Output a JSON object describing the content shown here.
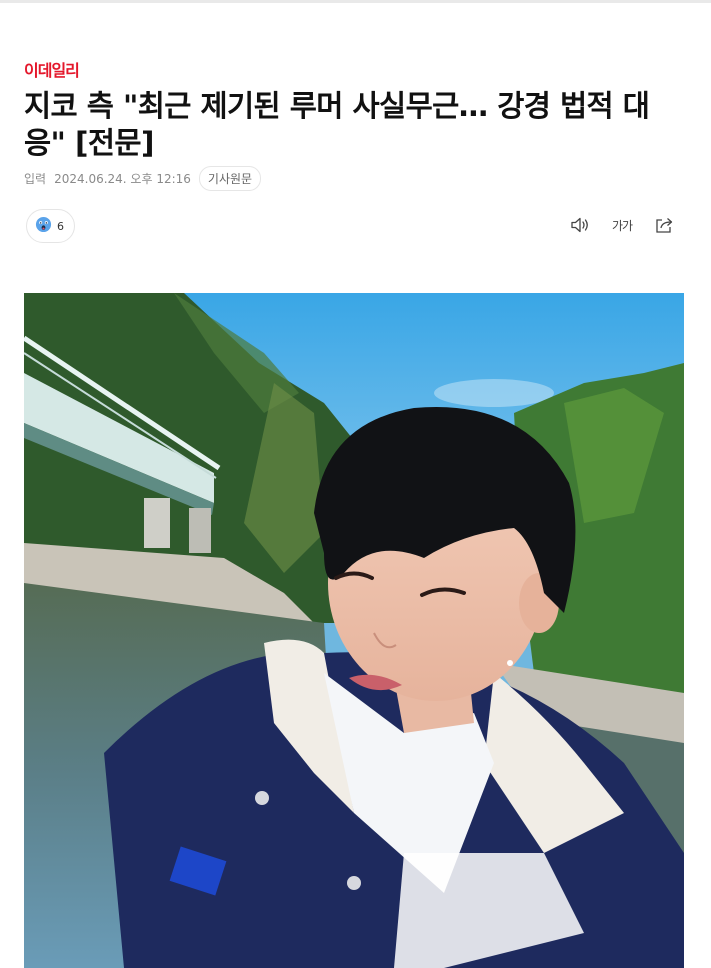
{
  "article": {
    "brand": "이데일리",
    "headline": "지코 측 \"최근 제기된 루머 사실무근… 강경 법적 대응\" [전문]",
    "published_label": "입력",
    "published_time": "2024.06.24. 오후 12:16",
    "source_link_label": "기사원문"
  },
  "reaction": {
    "icon": "surprised-face-icon",
    "count": "6"
  },
  "tools": {
    "audio_icon": "speaker-icon",
    "font_size_label": "가가",
    "share_icon": "share-icon"
  },
  "colors": {
    "brand": "#e4172b",
    "text": "#111111",
    "meta": "#8a8a8a"
  }
}
